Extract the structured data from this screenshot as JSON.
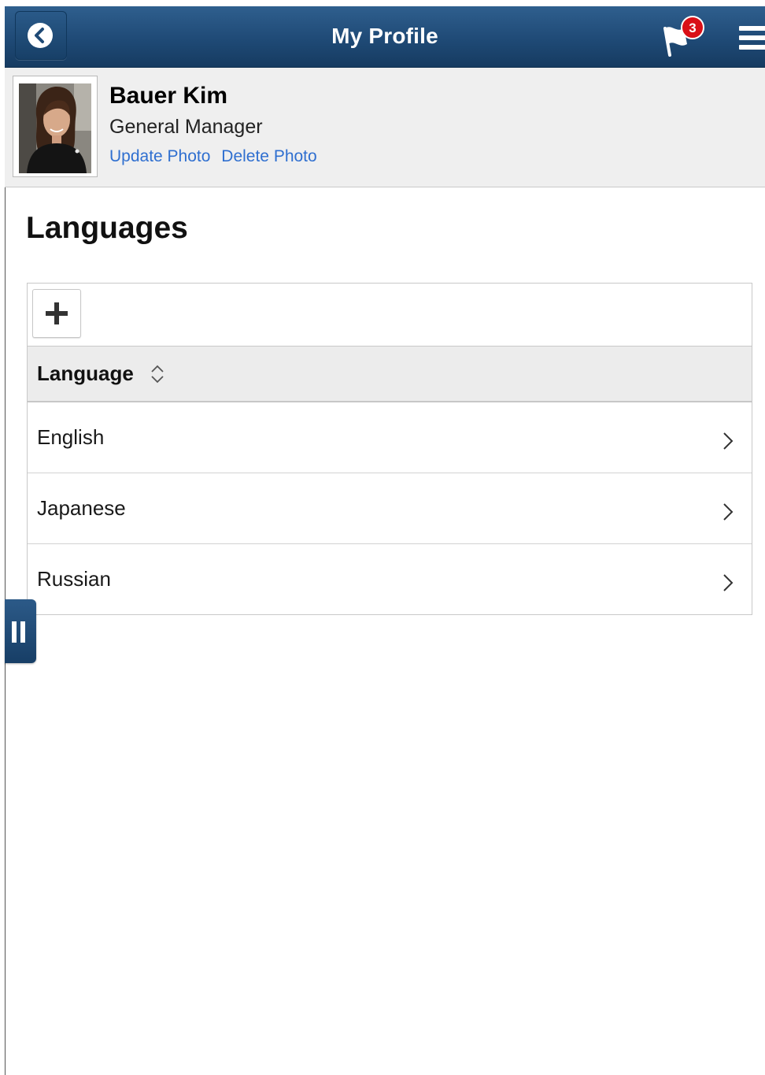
{
  "header": {
    "title": "My Profile",
    "notification_count": "3",
    "colors": {
      "bar": "#1f4a76",
      "badge": "#d90f17"
    }
  },
  "icons": {
    "back": "chevron-left",
    "notifications": "flag",
    "menu": "hamburger",
    "add": "plus",
    "sort": "up-down-chevrons",
    "row": "chevron-right",
    "side_handle": "pause-bars"
  },
  "profile": {
    "name": "Bauer Kim",
    "job_title": "General Manager",
    "update_photo": "Update Photo",
    "delete_photo": "Delete Photo",
    "link_color": "#2f6fd0"
  },
  "page": {
    "title": "Languages"
  },
  "grid": {
    "column_header": "Language",
    "rows": [
      {
        "label": "English"
      },
      {
        "label": "Japanese"
      },
      {
        "label": "Russian"
      }
    ]
  }
}
